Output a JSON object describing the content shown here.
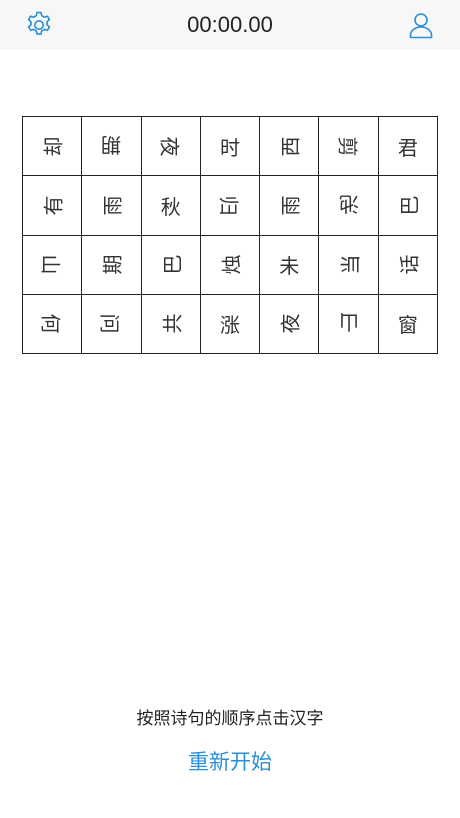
{
  "header": {
    "timer": "00:00.00",
    "settings_icon": "gear-icon",
    "user_icon": "user-icon",
    "accent_color": "#2a8fd6"
  },
  "grid": {
    "cells": [
      {
        "char": "却",
        "rot": 270
      },
      {
        "char": "期",
        "rot": 180
      },
      {
        "char": "夜",
        "rot": 90
      },
      {
        "char": "时",
        "rot": 0
      },
      {
        "char": "西",
        "rot": 270
      },
      {
        "char": "剪",
        "rot": 90
      },
      {
        "char": "君",
        "rot": 0
      },
      {
        "char": "有",
        "rot": 270
      },
      {
        "char": "雨",
        "rot": 270
      },
      {
        "char": "秋",
        "rot": 0
      },
      {
        "char": "归",
        "rot": 90
      },
      {
        "char": "雨",
        "rot": 270
      },
      {
        "char": "池",
        "rot": 180
      },
      {
        "char": "巴",
        "rot": 270
      },
      {
        "char": "山",
        "rot": 90
      },
      {
        "char": "期",
        "rot": 270
      },
      {
        "char": "巴",
        "rot": 270
      },
      {
        "char": "烛",
        "rot": 270
      },
      {
        "char": "未",
        "rot": 0
      },
      {
        "char": "当",
        "rot": 270
      },
      {
        "char": "话",
        "rot": 270
      },
      {
        "char": "何",
        "rot": 90
      },
      {
        "char": "问",
        "rot": 90
      },
      {
        "char": "共",
        "rot": 270
      },
      {
        "char": "涨",
        "rot": 0
      },
      {
        "char": "夜",
        "rot": 270
      },
      {
        "char": "山",
        "rot": 180
      },
      {
        "char": "窗",
        "rot": 0
      }
    ]
  },
  "footer": {
    "instruction": "按照诗句的顺序点击汉字",
    "restart_label": "重新开始"
  }
}
